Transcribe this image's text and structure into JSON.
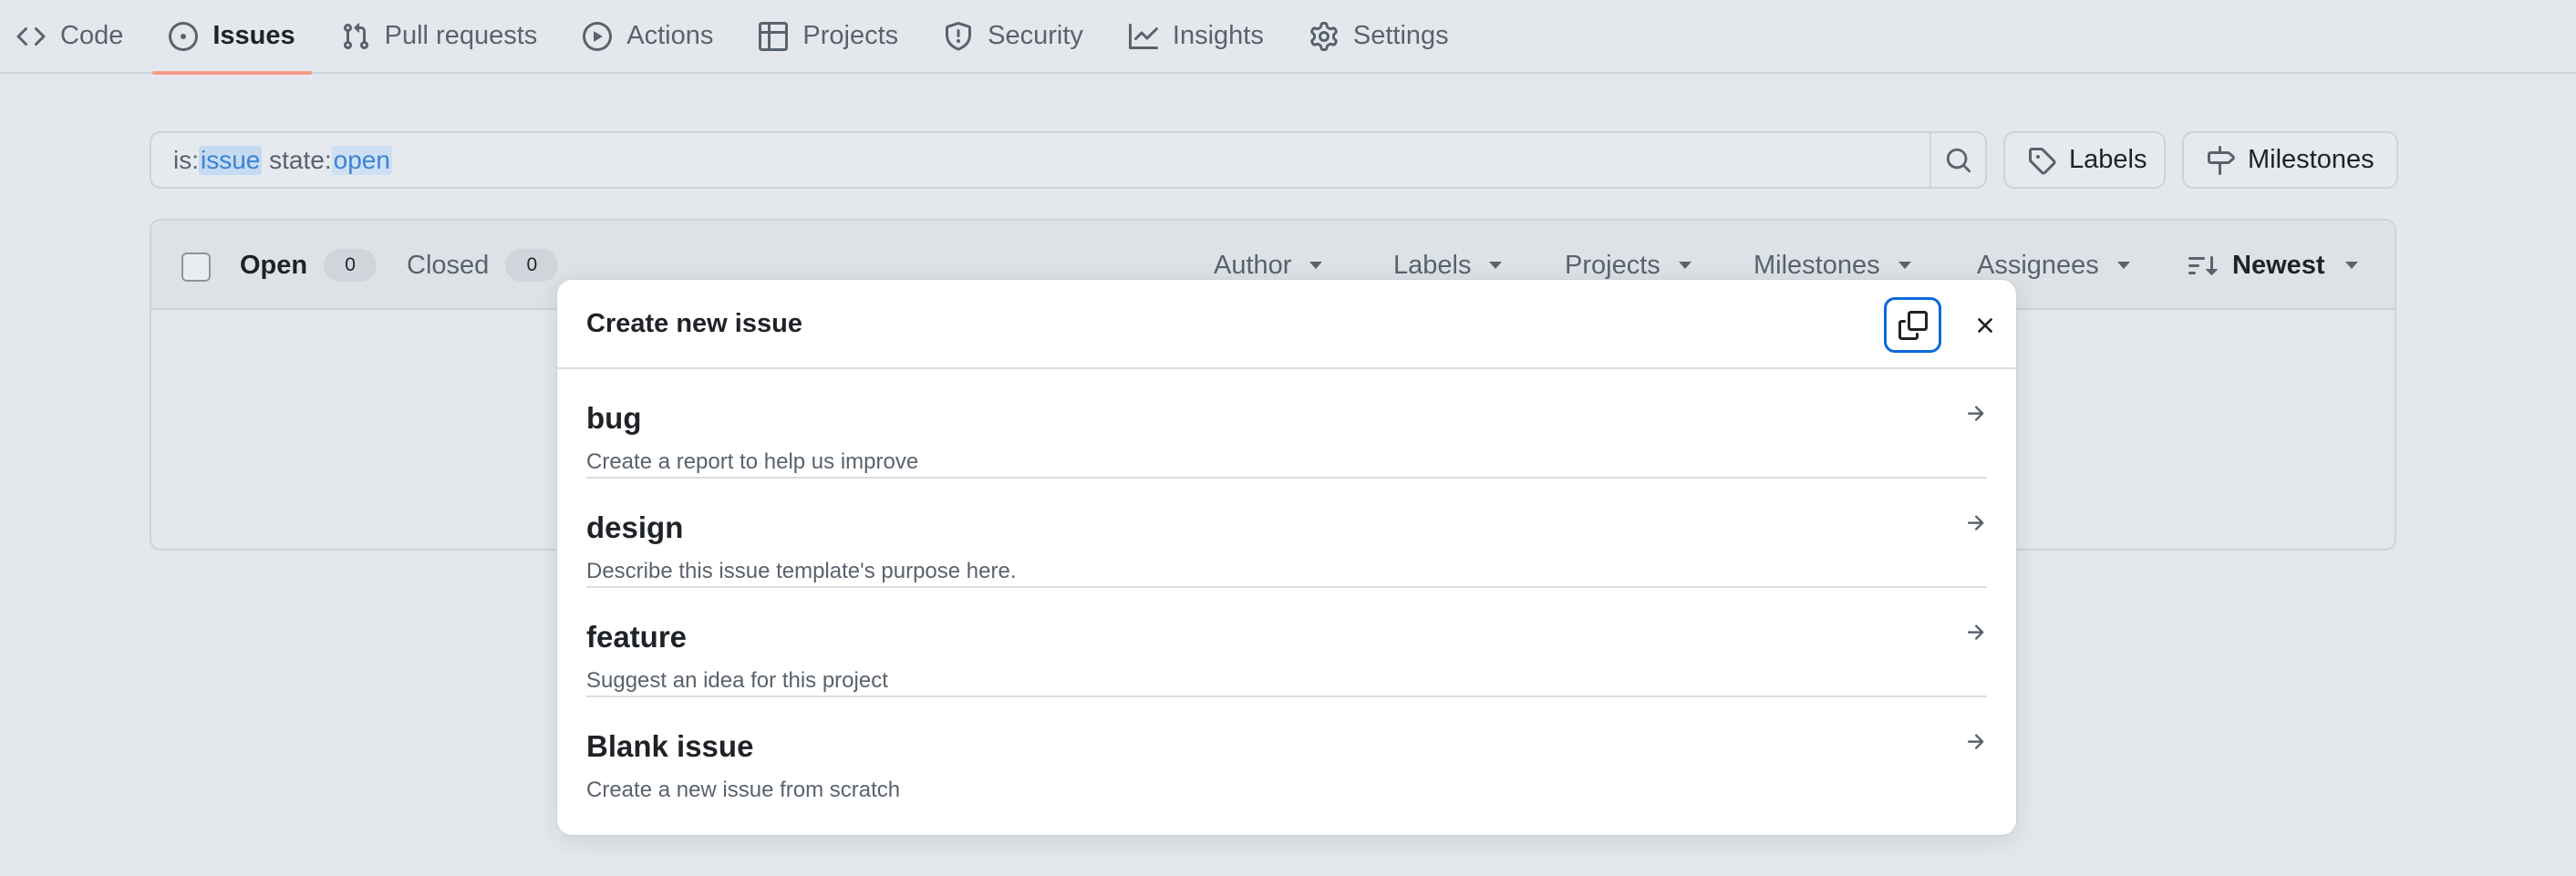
{
  "nav": {
    "items": [
      {
        "label": "Code",
        "icon": "code-icon",
        "active": false
      },
      {
        "label": "Issues",
        "icon": "issue-opened-icon",
        "active": true
      },
      {
        "label": "Pull requests",
        "icon": "git-pull-request-icon",
        "active": false
      },
      {
        "label": "Actions",
        "icon": "play-icon",
        "active": false
      },
      {
        "label": "Projects",
        "icon": "table-icon",
        "active": false
      },
      {
        "label": "Security",
        "icon": "shield-icon",
        "active": false
      },
      {
        "label": "Insights",
        "icon": "graph-icon",
        "active": false
      },
      {
        "label": "Settings",
        "icon": "gear-icon",
        "active": false
      }
    ],
    "active_underline_color": "#fd8c73"
  },
  "search": {
    "tokens": [
      {
        "text": "is:",
        "kind": "plain"
      },
      {
        "text": "issue",
        "kind": "value"
      },
      {
        "text": " state:",
        "kind": "plain"
      },
      {
        "text": "open",
        "kind": "value"
      }
    ],
    "search_icon": "search-icon"
  },
  "buttons": {
    "labels": "Labels",
    "milestones": "Milestones"
  },
  "list": {
    "open_label": "Open",
    "open_count": "0",
    "closed_label": "Closed",
    "closed_count": "0",
    "filters": {
      "author": "Author",
      "labels": "Labels",
      "projects": "Projects",
      "milestones": "Milestones",
      "assignees": "Assignees",
      "sort": "Newest"
    }
  },
  "dialog": {
    "title": "Create new issue",
    "focus_color": "#0969da",
    "templates": [
      {
        "name": "bug",
        "description": "Create a report to help us improve"
      },
      {
        "name": "design",
        "description": "Describe this issue template's purpose here."
      },
      {
        "name": "feature",
        "description": "Suggest an idea for this project"
      },
      {
        "name": "Blank issue",
        "description": "Create a new issue from scratch"
      }
    ]
  }
}
